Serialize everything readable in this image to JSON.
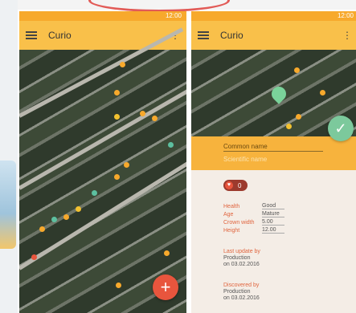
{
  "left_phone": {
    "status_time": "12:00",
    "title": "Curio",
    "fab_icon": "plus-icon"
  },
  "right_phone": {
    "status_time": "12:00",
    "title": "Curio",
    "name_placeholder": "Common name",
    "species_placeholder": "Scientific name",
    "chip_count": "0",
    "details": [
      {
        "label": "Health",
        "value": "Good"
      },
      {
        "label": "Age",
        "value": "Mature"
      },
      {
        "label": "Crown width",
        "value": "5.00"
      },
      {
        "label": "Height",
        "value": "12.00"
      }
    ],
    "last_update_label": "Last update by",
    "last_update_by": "Production",
    "last_update_on": "on 03.02.2016",
    "discovered_label": "Discovered by",
    "discovered_by": "Production",
    "discovered_on": "on 03.02.2016"
  },
  "colors": {
    "appbar": "#f9c04a",
    "statusbar": "#f7a92c",
    "fab": "#e8553d",
    "check": "#7cc99c"
  }
}
